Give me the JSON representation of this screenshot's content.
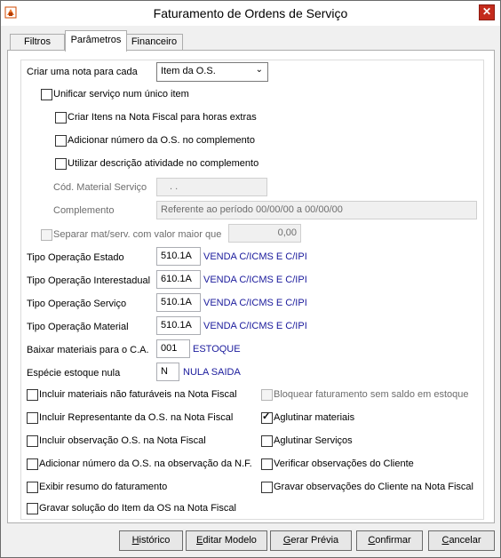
{
  "window": {
    "title": "Faturamento de Ordens de Serviço"
  },
  "tabs": [
    {
      "label": "Filtros"
    },
    {
      "label": "Parâmetros"
    },
    {
      "label": "Financeiro"
    }
  ],
  "params": {
    "criar_nota_label": "Criar uma nota para cada",
    "criar_nota_value": "Item da O.S.",
    "unificar_label": "Unificar serviço num único item",
    "criar_itens_label": "Criar Itens na Nota Fiscal para horas extras",
    "adicionar_numero_label": "Adicionar número da O.S. no complemento",
    "utilizar_descricao_label": "Utilizar descrição atividade no complemento",
    "cod_material_label": "Cód. Material Serviço",
    "cod_material_value": ". .",
    "complemento_label": "Complemento",
    "complemento_value": "Referente ao período 00/00/00 a 00/00/00",
    "separar_label": "Separar mat/serv. com valor maior que",
    "separar_value": "0,00",
    "tipo_estado_label": "Tipo Operação Estado",
    "tipo_estado_code": "510.1A",
    "tipo_estado_desc": "VENDA C/ICMS E C/IPI",
    "tipo_inter_label": "Tipo Operação Interestadual",
    "tipo_inter_code": "610.1A",
    "tipo_inter_desc": "VENDA C/ICMS E C/IPI",
    "tipo_servico_label": "Tipo Operação Serviço",
    "tipo_servico_code": "510.1A",
    "tipo_servico_desc": "VENDA C/ICMS E C/IPI",
    "tipo_material_label": "Tipo Operação Material",
    "tipo_material_code": "510.1A",
    "tipo_material_desc": "VENDA C/ICMS E C/IPI",
    "baixar_label": "Baixar materiais para o C.A.",
    "baixar_code": "001",
    "baixar_desc": "ESTOQUE",
    "especie_label": "Espécie estoque nula",
    "especie_code": "N",
    "especie_desc": "NULA SAIDA",
    "incluir_materiais_label": "Incluir materiais não faturáveis na Nota Fiscal",
    "bloquear_label": "Bloquear faturamento sem saldo em estoque",
    "incluir_representante_label": "Incluir Representante da O.S. na Nota Fiscal",
    "aglutinar_materiais_label": "Aglutinar materiais",
    "incluir_observacao_label": "Incluir observação O.S. na Nota Fiscal",
    "aglutinar_servicos_label": "Aglutinar Serviços",
    "adicionar_obs_label": "Adicionar número da O.S. na observação da N.F.",
    "verificar_obs_label": "Verificar observações do Cliente",
    "exibir_resumo_label": "Exibir resumo do faturamento",
    "gravar_obs_label": "Gravar observações do Cliente na Nota Fiscal",
    "gravar_solucao_label": "Gravar solução do Item da OS na Nota Fiscal"
  },
  "buttons": {
    "historico": {
      "first": "H",
      "rest": "istórico"
    },
    "editar_modelo": {
      "first": "E",
      "rest": "ditar Modelo"
    },
    "gerar_previa": {
      "first": "G",
      "rest": "erar Prévia"
    },
    "confirmar": {
      "first": "C",
      "rest": "onfirmar"
    },
    "cancelar": {
      "first": "C",
      "rest": "ancelar"
    }
  },
  "icons": {
    "app": "app-icon",
    "close": "close-icon",
    "dropdown": "chevron-down-icon"
  },
  "colors": {
    "close": "#c42b1c",
    "desc_text": "#1a1a9c"
  }
}
